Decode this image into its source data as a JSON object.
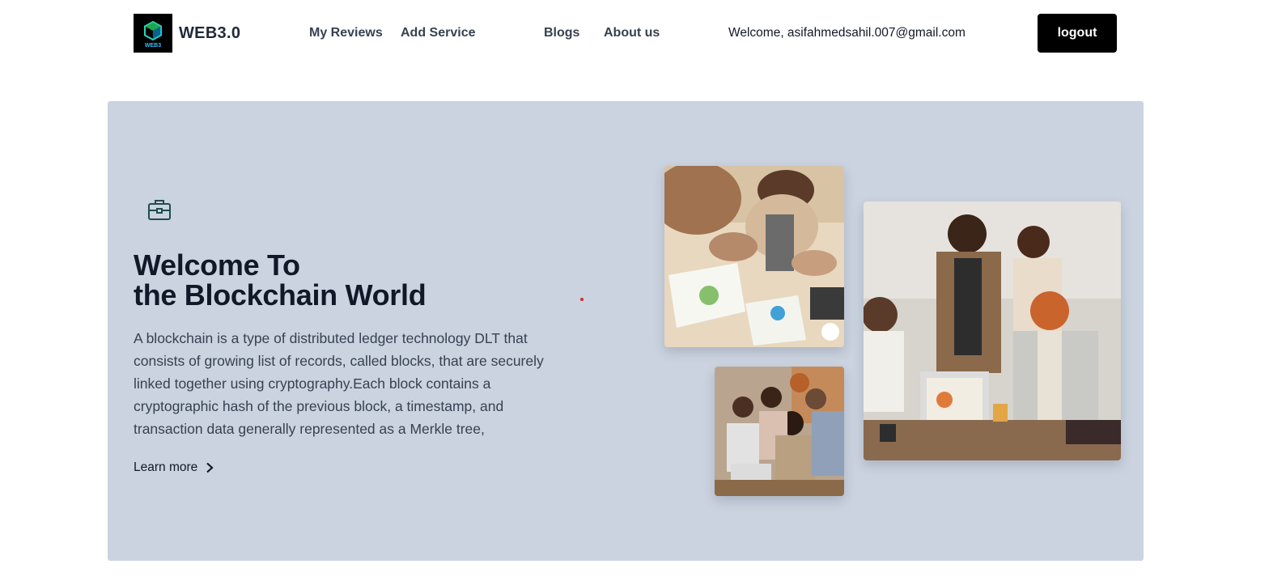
{
  "header": {
    "brand": "WEB3.0",
    "logo_text": "WEB3",
    "nav": [
      {
        "label": "My Reviews"
      },
      {
        "label": "Add Service"
      },
      {
        "label": "Blogs"
      },
      {
        "label": "About us"
      }
    ],
    "welcome_text": "Welcome, asifahmedsahil.007@gmail.com",
    "logout_label": "logout"
  },
  "hero": {
    "icon": "briefcase-icon",
    "title_line1": "Welcome To",
    "title_line2": "the Blockchain World",
    "description": "A blockchain is a type of distributed ledger technology DLT that consists of growing list of records, called blocks, that are securely linked together using cryptography.Each block contains a cryptographic hash of the previous block, a timestamp, and transaction data generally represented as a Merkle tree,",
    "learn_more_label": "Learn more",
    "learn_more_icon": "chevron-right-icon",
    "images": [
      "team-meeting-photo",
      "group-laptop-photo",
      "office-coffee-photo"
    ]
  },
  "colors": {
    "hero_bg": "#cbd3e0",
    "button_bg": "#000000",
    "accent_dot": "#dc2626",
    "icon_teal": "#1f4e4a"
  }
}
